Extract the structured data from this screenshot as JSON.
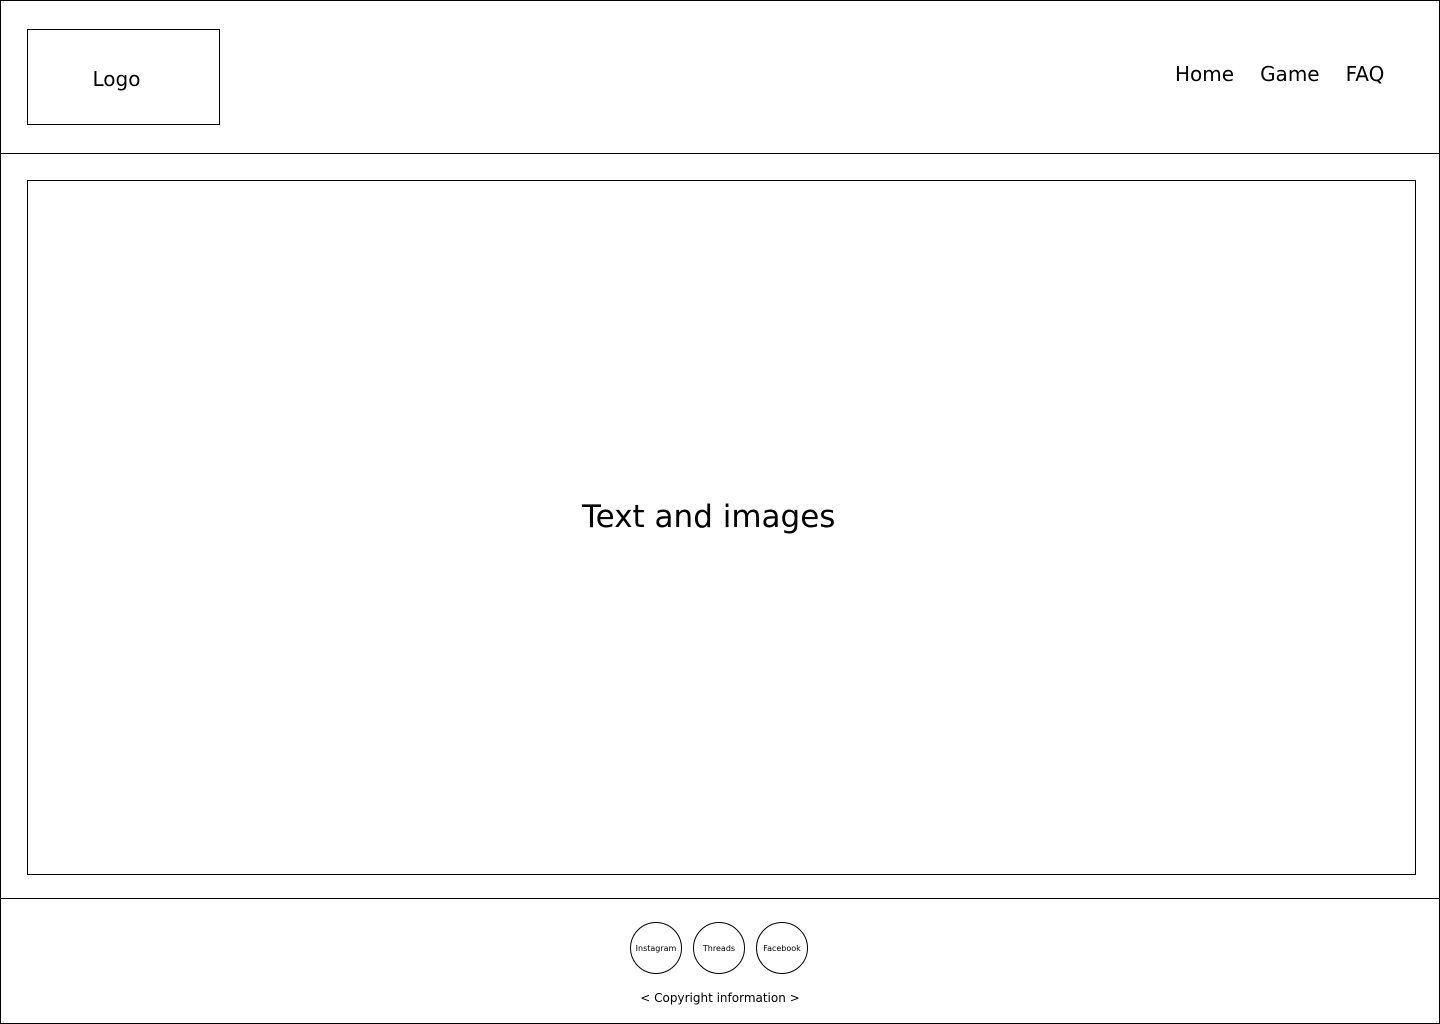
{
  "header": {
    "logo_label": "Logo",
    "nav": [
      {
        "label": "Home"
      },
      {
        "label": "Game"
      },
      {
        "label": "FAQ"
      }
    ]
  },
  "main": {
    "placeholder_text": "Text and images"
  },
  "footer": {
    "socials": [
      {
        "label": "Instagram"
      },
      {
        "label": "Threads"
      },
      {
        "label": "Facebook"
      }
    ],
    "copyright": "< Copyright information >"
  }
}
